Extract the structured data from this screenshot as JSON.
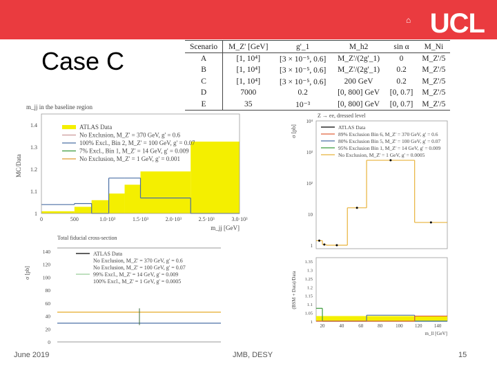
{
  "header": {
    "logo_text": "UCL",
    "accent": "#ea3b3f"
  },
  "slide": {
    "title": "Case C"
  },
  "table": {
    "headers": [
      "Scenario",
      "M_Z' [GeV]",
      "g'_1",
      "M_h2",
      "sin α",
      "M_Ni"
    ],
    "rows": [
      [
        "A",
        "[1, 10⁴]",
        "[3 × 10⁻⁵, 0.6]",
        "M_Z'/(2g'_1)",
        "0",
        "M_Z'/5"
      ],
      [
        "B",
        "[1, 10⁴]",
        "[3 × 10⁻⁵, 0.6]",
        "M_Z'/(2g'_1)",
        "0.2",
        "M_Z'/5"
      ],
      [
        "C",
        "[1, 10⁴]",
        "[3 × 10⁻⁵, 0.6]",
        "200 GeV",
        "0.2",
        "M_Z'/5"
      ],
      [
        "D",
        "7000",
        "0.2",
        "[0, 800] GeV",
        "[0, 0.7]",
        "M_Z'/5"
      ],
      [
        "E",
        "35",
        "10⁻³",
        "[0, 800] GeV",
        "[0, 0.7]",
        "M_Z'/5"
      ]
    ]
  },
  "footer": {
    "date": "June 2019",
    "author": "JMB, DESY",
    "page": "15"
  },
  "chart_data": [
    {
      "type": "bar",
      "title": "m_jj in the baseline region",
      "xlabel": "m_jj [GeV]",
      "ylabel": "MC/Data",
      "xlim": [
        0,
        3000
      ],
      "ylim": [
        1,
        1.45
      ],
      "xticks": [
        "0",
        "500",
        "1.0·10³",
        "1.5·10³",
        "2.0·10³",
        "2.5·10³",
        "3.0·10³"
      ],
      "yticks": [
        "1",
        "1.1",
        "1.2",
        "1.3",
        "1.4"
      ],
      "legend": [
        "ATLAS Data",
        "No Exclusion, M_Z' = 370 GeV, g' = 0.6",
        "100% Excl., Bin 2, M_Z' = 100 GeV, g' = 0.07",
        "7% Excl., Bin 1, M_Z' = 14 GeV, g' = 0.009",
        "No Exclusion, M_Z' = 1 GeV, g' = 0.001"
      ],
      "bin_edges": [
        0,
        500,
        760,
        1020,
        1260,
        1500,
        2260,
        3000
      ],
      "series": [
        {
          "name": "ATLAS Data",
          "values": [
            1.01,
            1.03,
            1.06,
            1.09,
            1.13,
            1.19,
            1.325
          ],
          "color": "#f4ef00"
        },
        {
          "name": "100% Excl., Bin 2, M_Z' = 100 GeV, g' = 0.07",
          "values": [
            1.04,
            1.045,
            1.0,
            1.16,
            1.16,
            1.07,
            1.0
          ],
          "color": "#4a6fa5"
        }
      ]
    },
    {
      "type": "line",
      "title": "Total fiducial cross-section",
      "ylabel": "σ [pb]",
      "ylim": [
        0,
        140
      ],
      "yticks": [
        "0",
        "20",
        "40",
        "60",
        "80",
        "100",
        "120",
        "140"
      ],
      "legend": [
        "ATLAS Data",
        "No Exclusion, M_Z' = 370 GeV, g' = 0.6",
        "No Exclusion, M_Z' = 100 GeV, g' = 0.07",
        "99% Excl., M_Z' = 14 GeV, g' = 0.009",
        "100% Excl., M_Z' = 1 GeV, g' = 0.0005"
      ],
      "series": [
        {
          "name": "ATLAS Data",
          "value": 46,
          "color": "#e8b23a"
        },
        {
          "name": "No Exclusion, M_Z' = 100 GeV, g' = 0.07",
          "value": 29,
          "color": "#4a6fa5"
        }
      ]
    },
    {
      "type": "line",
      "title": "Z → ee, dressed level",
      "ylabel": "σ [pb]",
      "xlabel": "m_ll [GeV]",
      "log_y": true,
      "ylim": [
        0.8,
        10000
      ],
      "yticks": [
        "1",
        "10",
        "10²",
        "10³",
        "10⁴"
      ],
      "legend": [
        "ATLAS Data",
        "89% Exclusion Bin 6, M_Z' = 370 GeV, g' = 0.6",
        "80% Exclusion Bin 5, M_Z' = 100 GeV, g' = 0.07",
        "95% Exclusion Bin 1, M_Z' = 14 GeV, g' = 0.009",
        "No Exclusion, M_Z' = 1 GeV, g' = 0.0005"
      ],
      "bin_edges": [
        13.5,
        20,
        24,
        46,
        66,
        116,
        150
      ],
      "values": [
        1.4,
        1.05,
        1.0,
        16,
        540,
        5.4
      ]
    },
    {
      "type": "line",
      "ylabel": "(BSM + Data)/Data",
      "xlabel": "m_ll [GeV]",
      "xlim": [
        13.5,
        150
      ],
      "ylim": [
        1,
        1.37
      ],
      "xticks": [
        "20",
        "40",
        "60",
        "80",
        "100",
        "120",
        "140"
      ],
      "yticks": [
        "1",
        "1.05",
        "1.1",
        "1.15",
        "1.2",
        "1.25",
        "1.3",
        "1.35"
      ],
      "bin_edges": [
        13.5,
        20,
        66,
        116,
        150
      ],
      "series": [
        {
          "name": "ATLAS Data",
          "values": [
            1.03,
            1.03,
            1.03,
            1.03
          ],
          "color": "#f4ef00"
        },
        {
          "name": "95% Exclusion Bin 1",
          "values": [
            1.075,
            1.0,
            1.0,
            1.0
          ],
          "color": "#3a9a3a"
        },
        {
          "name": "80% Exclusion Bin 5",
          "values": [
            1.0,
            1.0,
            1.035,
            1.0
          ],
          "color": "#4a6fa5"
        },
        {
          "name": "89% Exclusion Bin 6",
          "values": [
            1.0,
            1.0,
            1.0,
            1.03
          ],
          "color": "#e0603a"
        }
      ]
    }
  ]
}
